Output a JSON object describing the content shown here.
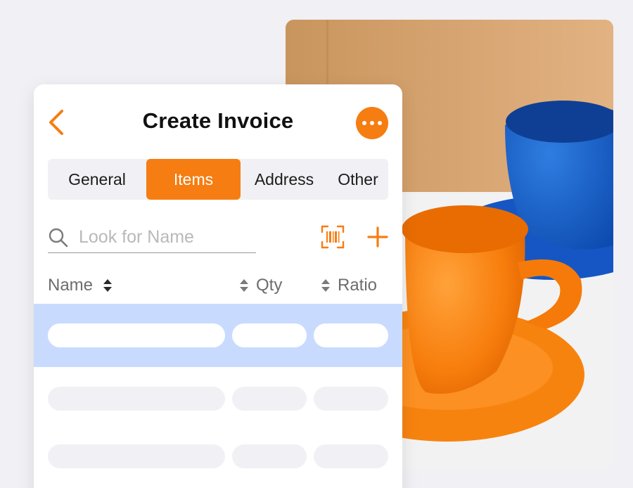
{
  "header": {
    "title": "Create Invoice"
  },
  "tabs": [
    {
      "label": "General",
      "active": false
    },
    {
      "label": "Items",
      "active": true
    },
    {
      "label": "Address",
      "active": false
    },
    {
      "label": "Other",
      "active": false
    }
  ],
  "search": {
    "placeholder": "Look for Name",
    "value": ""
  },
  "columns": {
    "name": "Name",
    "qty": "Qty",
    "ratio": "Ratio"
  },
  "rows": [
    {
      "selected": true
    },
    {
      "selected": false
    },
    {
      "selected": false
    }
  ],
  "colors": {
    "accent": "#f57d12",
    "selected_row": "#c8dbff",
    "placeholder_pill": "#f1f0f4",
    "background": "#f1f0f4"
  },
  "icons": {
    "back": "chevron-left-icon",
    "more": "more-horizontal-icon",
    "search": "search-icon",
    "scan": "barcode-scan-icon",
    "add": "plus-icon",
    "sort": "sort-icon"
  }
}
